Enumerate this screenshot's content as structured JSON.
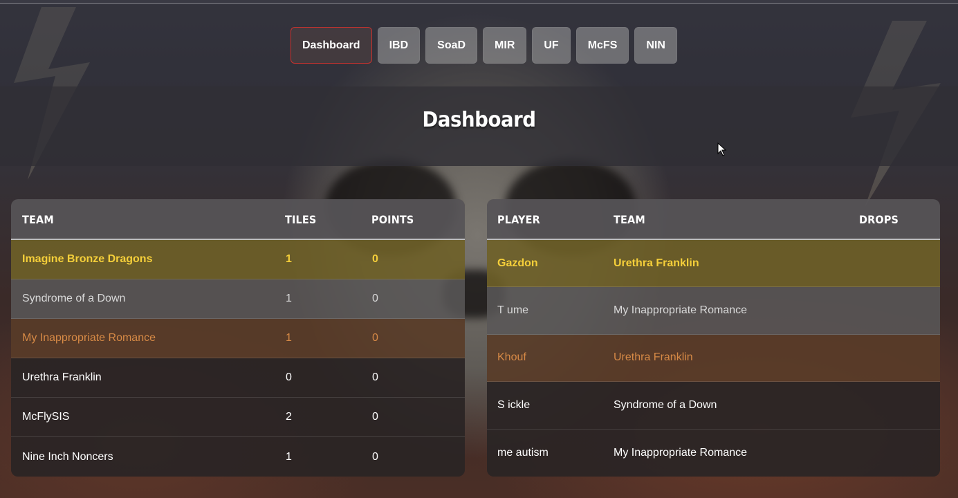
{
  "nav": {
    "items": [
      {
        "label": "Dashboard",
        "active": true
      },
      {
        "label": "IBD",
        "active": false
      },
      {
        "label": "SoaD",
        "active": false
      },
      {
        "label": "MIR",
        "active": false
      },
      {
        "label": "UF",
        "active": false
      },
      {
        "label": "McFS",
        "active": false
      },
      {
        "label": "NIN",
        "active": false
      }
    ]
  },
  "page": {
    "title": "Dashboard"
  },
  "teams_table": {
    "headers": {
      "team": "TEAM",
      "tiles": "TILES",
      "points": "POINTS"
    },
    "rows": [
      {
        "team": "Imagine Bronze Dragons",
        "tiles": "1",
        "points": "0",
        "rank_style": "gold"
      },
      {
        "team": "Syndrome of a Down",
        "tiles": "1",
        "points": "0",
        "rank_style": "silver"
      },
      {
        "team": "My Inappropriate Romance",
        "tiles": "1",
        "points": "0",
        "rank_style": "bronze"
      },
      {
        "team": "Urethra Franklin",
        "tiles": "0",
        "points": "0",
        "rank_style": "plain"
      },
      {
        "team": "McFlySIS",
        "tiles": "2",
        "points": "0",
        "rank_style": "plain"
      },
      {
        "team": "Nine Inch Noncers",
        "tiles": "1",
        "points": "0",
        "rank_style": "plain"
      }
    ]
  },
  "players_table": {
    "headers": {
      "player": "PLAYER",
      "team": "TEAM",
      "drops": "DROPS"
    },
    "rows": [
      {
        "player": "Gazdon",
        "team": "Urethra Franklin",
        "drops": "",
        "rank_style": "gold"
      },
      {
        "player": "T ume",
        "team": "My Inappropriate Romance",
        "drops": "",
        "rank_style": "silver"
      },
      {
        "player": "Khouf",
        "team": "Urethra Franklin",
        "drops": "",
        "rank_style": "bronze"
      },
      {
        "player": "S ickle",
        "team": "Syndrome of a Down",
        "drops": "",
        "rank_style": "plain"
      },
      {
        "player": "me autism",
        "team": "My Inappropriate Romance",
        "drops": "",
        "rank_style": "plain"
      }
    ]
  },
  "colors": {
    "active_border": "#c8322e",
    "gold_text": "#f5cf3a",
    "silver_text": "#d8d8d8",
    "bronze_text": "#d78a46"
  }
}
